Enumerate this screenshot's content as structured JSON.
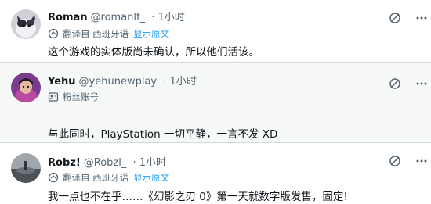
{
  "tweets": [
    {
      "name": "Roman",
      "handle": "@romanlf_",
      "time": "· 1小时",
      "sub_label": "翻译自 西班牙语",
      "sub_link": "显示原文",
      "text": "这个游戏的实体版尚未确认，所以他们活该。"
    },
    {
      "name": "Yehu",
      "handle": "@yehunewplay",
      "time": "· 1小时",
      "sub_label": "粉丝账号",
      "sub_link": "",
      "text": "与此同时，PlayStation 一切平静，一言不发 XD"
    },
    {
      "name": "Robz!",
      "handle": "@Robzl_",
      "time": "· 1小时",
      "sub_label": "翻译自 西班牙语",
      "sub_link": "显示原文",
      "text": "我一点也不在乎……《幻影之刃 0》第一天就数字版发售，固定!"
    }
  ],
  "icons": {
    "translate": "translate-icon",
    "fan_account": "fan-account-icon",
    "grok": "grok-icon",
    "more": "more-icon"
  },
  "colors": {
    "accent": "#1d9bf0",
    "muted": "#536471",
    "text": "#0f1419",
    "divider": "#cfd9de",
    "highlight_bg": "#f7f9f9"
  }
}
